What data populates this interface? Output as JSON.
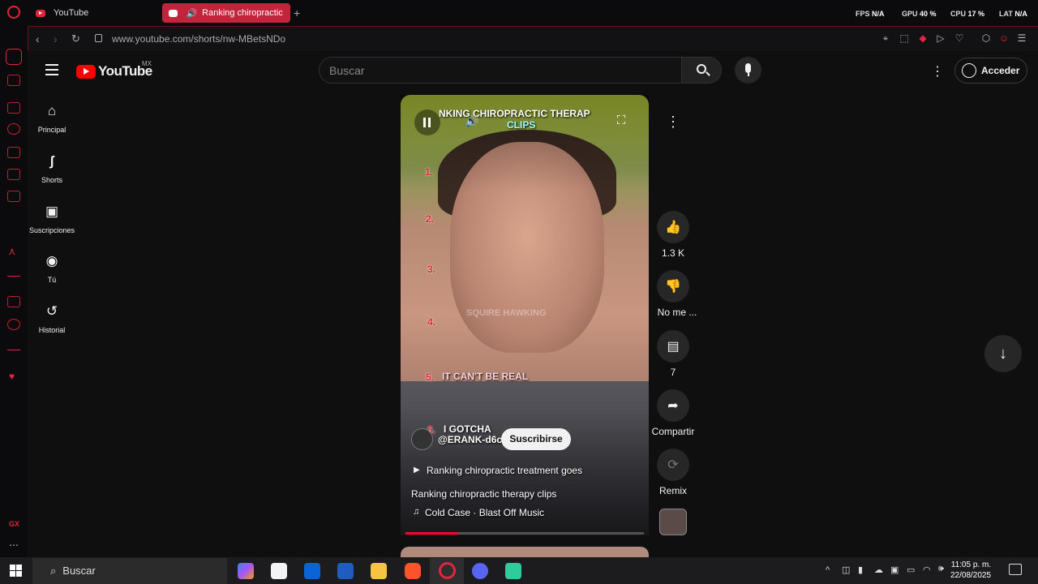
{
  "browser": {
    "tabs": [
      {
        "label": "YouTube"
      },
      {
        "label": "Ranking chiropractic t"
      }
    ],
    "new_tab": "+",
    "url": "www.youtube.com/shorts/nw-MBetsNDo",
    "stats": {
      "fps_label": "FPS",
      "fps": "N/A",
      "gpu_label": "GPU",
      "gpu": "40 %",
      "cpu_label": "CPU",
      "cpu": "17 %",
      "lat_label": "LAT",
      "lat": "N/A"
    }
  },
  "youtube": {
    "logo": "YouTube",
    "region": "MX",
    "search_placeholder": "Buscar",
    "signin": "Acceder",
    "guide": [
      {
        "label": "Principal"
      },
      {
        "label": "Shorts"
      },
      {
        "label": "Suscripciones"
      },
      {
        "label": "Tú"
      },
      {
        "label": "Historial"
      }
    ]
  },
  "short": {
    "overlay_title_1": "NKING CHIROPRACTIC THERAP",
    "overlay_title_2": "CLIPS",
    "ranks": [
      "1.",
      "2.",
      "3.",
      "4.",
      "5.",
      "6."
    ],
    "rank5_text": "IT CAN'T BE REAL",
    "rank6_text": "I GOTCHA",
    "watermark": "SQUIRE HAWKING",
    "channel": "@ERANK-d6c",
    "subscribe": "Suscribirse",
    "playlist": "Ranking chiropractic treatment goes",
    "title": "Ranking chiropractic therapy clips",
    "music": "Cold Case · Blast Off Music",
    "progress": 0.22
  },
  "actions": {
    "likes": "1.3 K",
    "dislike": "No me ...",
    "comments": "7",
    "share": "Compartir",
    "remix": "Remix"
  },
  "taskbar": {
    "search": "Buscar",
    "time": "11:05 p. m.",
    "date": "22/08/2025"
  }
}
